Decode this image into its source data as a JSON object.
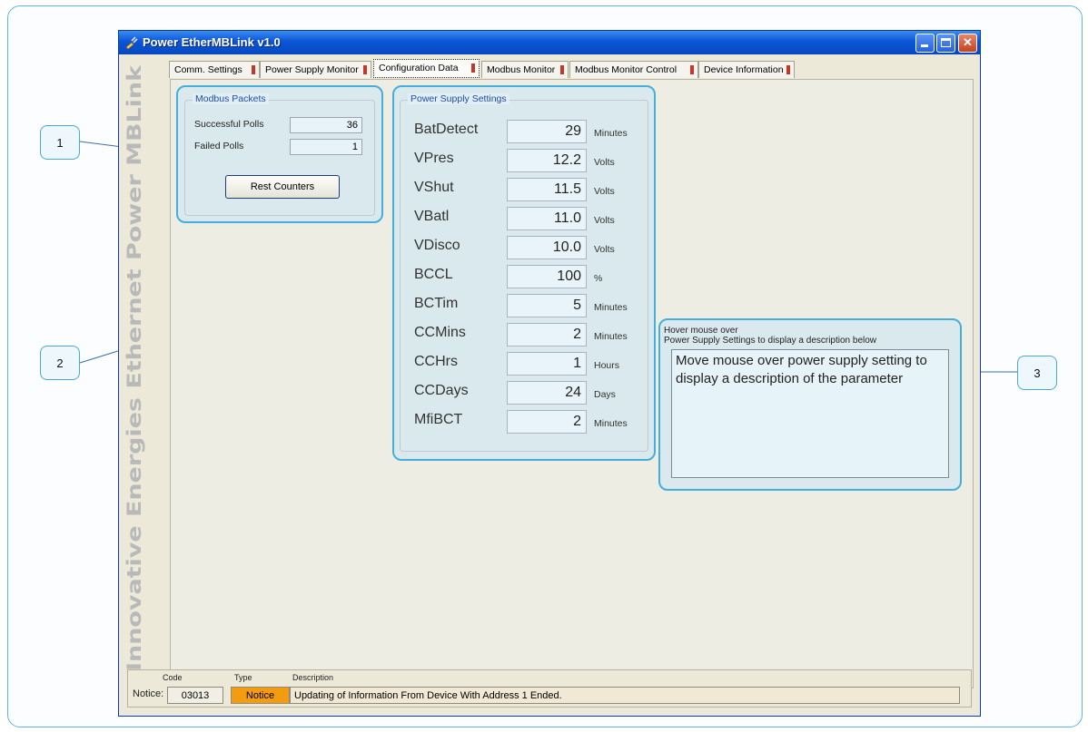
{
  "window": {
    "title": "Power EtherMBLink v1.0"
  },
  "sidebar_brand": "Innovative Energies Ethernet Power MBLink",
  "tabs": [
    {
      "label": "Comm. Settings"
    },
    {
      "label": "Power Supply Monitor"
    },
    {
      "label": "Configuration Data",
      "active": true
    },
    {
      "label": "Modbus Monitor"
    },
    {
      "label": "Modbus Monitor Control"
    },
    {
      "label": "Device Information"
    }
  ],
  "modbus_packets": {
    "title": "Modbus Packets",
    "successful_label": "Successful Polls",
    "successful_value": "36",
    "failed_label": "Failed Polls",
    "failed_value": "1",
    "reset_button": "Rest Counters"
  },
  "power_supply": {
    "title": "Power Supply Settings",
    "rows": [
      {
        "label": "BatDetect",
        "value": "29",
        "unit": "Minutes"
      },
      {
        "label": "VPres",
        "value": "12.2",
        "unit": "Volts"
      },
      {
        "label": "VShut",
        "value": "11.5",
        "unit": "Volts"
      },
      {
        "label": "VBatl",
        "value": "11.0",
        "unit": "Volts"
      },
      {
        "label": "VDisco",
        "value": "10.0",
        "unit": "Volts"
      },
      {
        "label": "BCCL",
        "value": "100",
        "unit": "%"
      },
      {
        "label": "BCTim",
        "value": "5",
        "unit": "Minutes"
      },
      {
        "label": "CCMins",
        "value": "2",
        "unit": "Minutes"
      },
      {
        "label": "CCHrs",
        "value": "1",
        "unit": "Hours"
      },
      {
        "label": "CCDays",
        "value": "24",
        "unit": "Days"
      },
      {
        "label": "MfiBCT",
        "value": "2",
        "unit": "Minutes"
      }
    ]
  },
  "description": {
    "header_line1": "Hover mouse over",
    "header_line2": "Power Supply Settings to display a description below",
    "text": "Move mouse over power supply setting to display a description of the parameter"
  },
  "callouts": [
    "1",
    "2",
    "3"
  ],
  "status": {
    "notice_label": "Notice:",
    "code_header": "Code",
    "type_header": "Type",
    "desc_header": "Description",
    "code": "03013",
    "type": "Notice",
    "description": "Updating of Information From Device With Address 1 Ended.",
    "type_color": "#f39c12"
  }
}
